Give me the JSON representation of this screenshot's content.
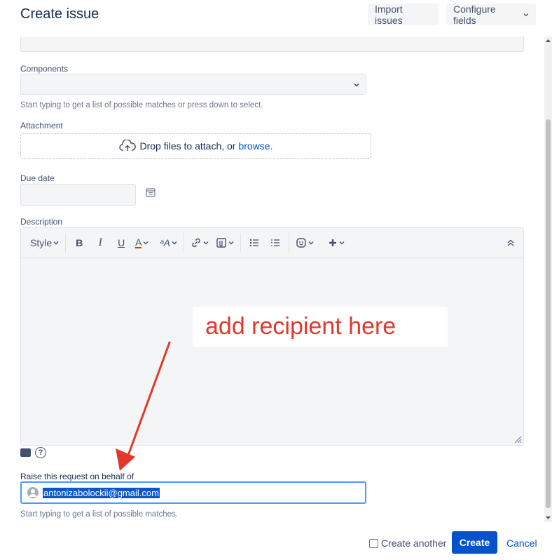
{
  "header": {
    "title": "Create issue",
    "import_label": "Import issues",
    "configure_label": "Configure fields"
  },
  "components": {
    "label": "Components",
    "hint": "Start typing to get a list of possible matches or press down to select."
  },
  "attachment": {
    "label": "Attachment",
    "drop_text": "Drop files to attach, or",
    "browse_label": "browse."
  },
  "due_date": {
    "label": "Due date",
    "value": ""
  },
  "description": {
    "label": "Description",
    "toolbar": {
      "style_label": "Style",
      "bold": "B",
      "italic": "I",
      "underline": "U",
      "text_color": "A",
      "text_effects": "ᵃA"
    },
    "value": ""
  },
  "annotation": {
    "callout_text": "add recipient here",
    "color": "#e0392b"
  },
  "on_behalf": {
    "label": "Raise this request on behalf of",
    "value": "antonizabolockii@gmail.com",
    "hint": "Start typing to get a list of possible matches."
  },
  "footer": {
    "create_another_label": "Create another",
    "create_another_checked": false,
    "create_label": "Create",
    "cancel_label": "Cancel"
  },
  "colors": {
    "primary": "#0052cc",
    "focus_border": "#4c9aff",
    "selection": "#0b57d0"
  }
}
